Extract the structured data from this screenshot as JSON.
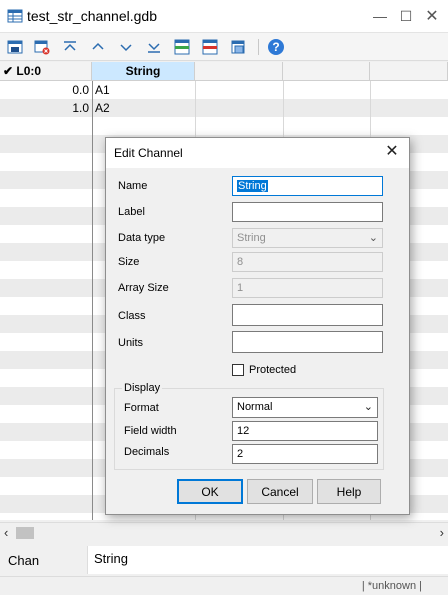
{
  "window": {
    "title": "test_str_channel.gdb"
  },
  "toolbar": {
    "buttons": [
      "save-icon",
      "delete-icon",
      "first-icon",
      "previous-icon",
      "next-icon",
      "last-icon",
      "insert-channel-icon",
      "delete-channel-icon",
      "properties-icon",
      "help-icon"
    ]
  },
  "grid": {
    "columns": [
      "✔ L0:0",
      "String"
    ],
    "rows": [
      {
        "index": "0.0",
        "value": "A1"
      },
      {
        "index": "1.0",
        "value": "A2"
      }
    ]
  },
  "chan": {
    "label": "Chan",
    "value": "String"
  },
  "status": {
    "text": "| *unknown |"
  },
  "dialog": {
    "title": "Edit Channel",
    "name_label": "Name",
    "name_value": "String",
    "label_label": "Label",
    "label_value": "",
    "datatype_label": "Data type",
    "datatype_value": "String",
    "size_label": "Size",
    "size_value": "8",
    "arraysize_label": "Array Size",
    "arraysize_value": "1",
    "class_label": "Class",
    "class_value": "",
    "units_label": "Units",
    "units_value": "",
    "protected_label": "Protected",
    "display_group": "Display",
    "format_label": "Format",
    "format_value": "Normal",
    "fieldwidth_label": "Field width",
    "fieldwidth_value": "12",
    "decimals_label": "Decimals",
    "decimals_value": "2",
    "ok_label": "OK",
    "cancel_label": "Cancel",
    "help_label": "Help"
  },
  "colors": {
    "accent": "#0078d7",
    "selected_header": "#cce8ff"
  }
}
